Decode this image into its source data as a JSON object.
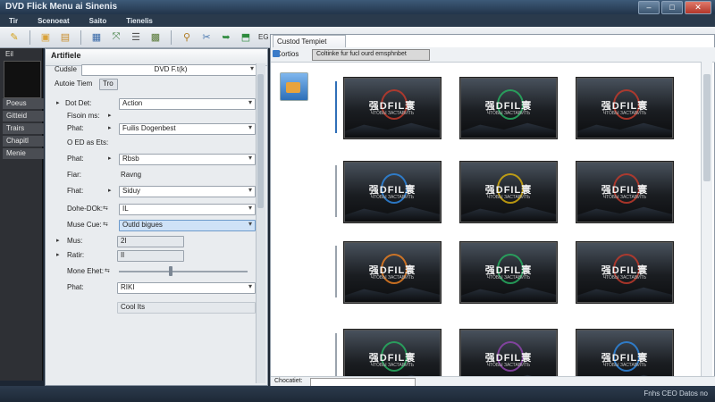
{
  "window": {
    "title": "DVD Flick  Menu ai Sinenis"
  },
  "menu": [
    "Tir",
    "Scenoeat",
    "Saito",
    "Tienelis"
  ],
  "toolbar": {
    "text_button": "EG DVD"
  },
  "sidebar": {
    "header": "Eil",
    "items": [
      "Poeus",
      "Gitteid",
      "Trairs",
      "Chapitl",
      "Menie"
    ]
  },
  "props": {
    "header": "Artifiele",
    "rows": [
      {
        "label": "Cudsle",
        "value": "DVD F.t(k)",
        "kind": "combo"
      },
      {
        "label": "Autoie  Tiem",
        "value": "Tro",
        "kind": "tab"
      },
      {
        "label": "Dot Det:",
        "value": "Action",
        "kind": "combo"
      },
      {
        "label": "Fisoin ms:",
        "value": "",
        "kind": "none"
      },
      {
        "label": "Phat:",
        "value": "Fuilis Dogenbest",
        "kind": "combo"
      },
      {
        "label": "O ED as Ets:",
        "value": "",
        "kind": "none"
      },
      {
        "label": "Phat:",
        "value": "Rbsb",
        "kind": "combo"
      },
      {
        "label": "Fiar:",
        "value": "Ravng",
        "kind": "plain"
      },
      {
        "label": "Fhat:",
        "value": "Siduy",
        "kind": "combo"
      },
      {
        "label": "Dohe-DOk:",
        "value": "IL",
        "kind": "combo"
      },
      {
        "label": "Muse Cue:",
        "value": "Outld bigues",
        "kind": "combo-hl"
      },
      {
        "label": "Mus:",
        "value": "2I",
        "kind": "plain"
      },
      {
        "label": "Ratir:",
        "value": "Il",
        "kind": "plain"
      },
      {
        "label": "Mone Ehet:",
        "value": "",
        "kind": "slider"
      },
      {
        "label": "Phat:",
        "value": "RIKI",
        "kind": "combo"
      },
      {
        "label": "",
        "value": "Cool Its",
        "kind": "plain"
      }
    ]
  },
  "main": {
    "tab_label": "Custod Tempiet",
    "sub_label": "Cortios",
    "filter_text": "Coltinke fur fucl ourd emsphnbet",
    "bottom_label": "Chocatiet:",
    "templates": [
      {
        "title": "强DFIL寰",
        "subtitle": "ЧТОБЫ ЗАСТАВИТЬ",
        "ring": "#c0392b"
      },
      {
        "title": "强DFIL寰",
        "subtitle": "ЧТОБЫ ЗАСТАВИТЬ",
        "ring": "#27ae60"
      },
      {
        "title": "强DFIL寰",
        "subtitle": "ЧТОБЫ ЗАСТАВИТЬ",
        "ring": "#c0392b"
      },
      {
        "title": "强DFIL寰",
        "subtitle": "ЧТОБЫ ЗАСТАВИТЬ",
        "ring": "#2e86de"
      },
      {
        "title": "强DFIL寰",
        "subtitle": "ЧТОБЫ ЗАСТАВИТЬ",
        "ring": "#d4ac0d"
      },
      {
        "title": "强DFIL寰",
        "subtitle": "ЧТОБЫ ЗАСТАВИТЬ",
        "ring": "#c0392b"
      },
      {
        "title": "强DFIL寰",
        "subtitle": "ЧТОБЫ ЗАСТАВИТЬ",
        "ring": "#e67e22"
      },
      {
        "title": "强DFIL寰",
        "subtitle": "ЧТОБЫ ЗАСТАВИТЬ",
        "ring": "#27ae60"
      },
      {
        "title": "强DFIL寰",
        "subtitle": "ЧТОБЫ ЗАСТАВИТЬ",
        "ring": "#c0392b"
      },
      {
        "title": "强DFIL寰",
        "subtitle": "ЧТОБЫ ЗАСТАВИТЬ",
        "ring": "#27ae60"
      },
      {
        "title": "强DFIL寰",
        "subtitle": "ЧТОБЫ ЗАСТАВИТЬ",
        "ring": "#8e44ad"
      },
      {
        "title": "强DFIL寰",
        "subtitle": "ЧТОБЫ ЗАСТАВИТЬ",
        "ring": "#2e86de"
      }
    ]
  },
  "status": {
    "text": "Fnhs  CEO Datos  no"
  }
}
